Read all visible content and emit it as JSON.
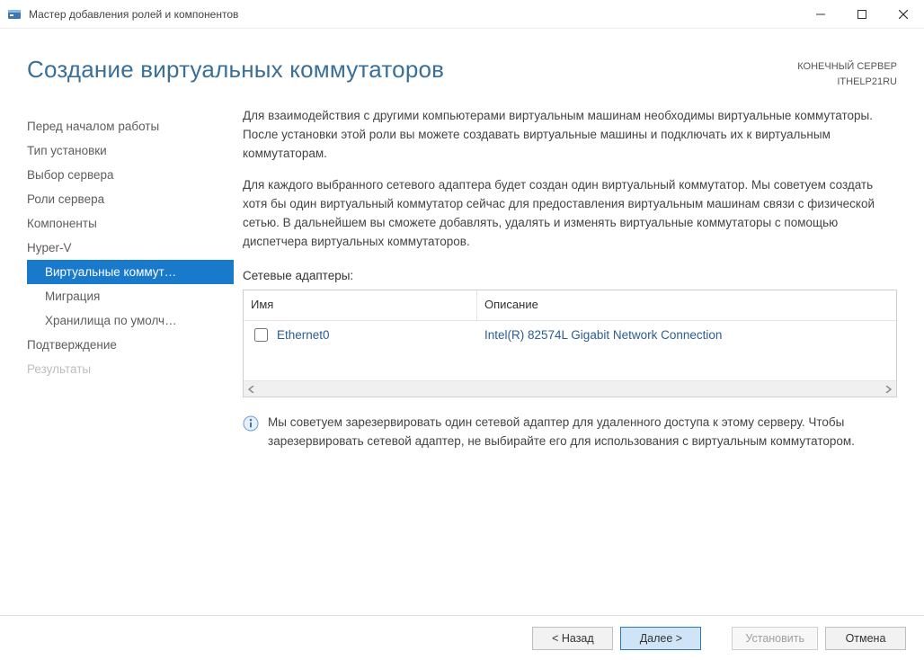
{
  "window": {
    "title": "Мастер добавления ролей и компонентов"
  },
  "header": {
    "page_title": "Создание виртуальных коммутаторов",
    "dest_label": "КОНЕЧНЫЙ СЕРВЕР",
    "dest_server": "ITHELP21RU"
  },
  "sidebar": {
    "items": [
      {
        "label": "Перед началом работы",
        "type": "normal"
      },
      {
        "label": "Тип установки",
        "type": "normal"
      },
      {
        "label": "Выбор сервера",
        "type": "normal"
      },
      {
        "label": "Роли сервера",
        "type": "normal"
      },
      {
        "label": "Компоненты",
        "type": "normal"
      },
      {
        "label": "Hyper-V",
        "type": "normal"
      },
      {
        "label": "Виртуальные коммут…",
        "type": "selected-sub"
      },
      {
        "label": "Миграция",
        "type": "sub"
      },
      {
        "label": "Хранилища по умолч…",
        "type": "sub"
      },
      {
        "label": "Подтверждение",
        "type": "normal"
      },
      {
        "label": "Результаты",
        "type": "disabled"
      }
    ]
  },
  "content": {
    "para1": "Для взаимодействия с другими компьютерами виртуальным машинам необходимы виртуальные коммутаторы. После установки этой роли вы можете создавать виртуальные машины и подключать их к виртуальным коммутаторам.",
    "para2": "Для каждого выбранного сетевого адаптера будет создан один виртуальный коммутатор. Мы советуем создать хотя бы один виртуальный коммутатор сейчас для предоставления виртуальным машинам связи с физической сетью. В дальнейшем вы сможете добавлять, удалять и изменять виртуальные коммутаторы с помощью диспетчера виртуальных коммутаторов.",
    "adapters_label": "Сетевые адаптеры:",
    "columns": {
      "name": "Имя",
      "desc": "Описание"
    },
    "rows": [
      {
        "name": "Ethernet0",
        "desc": "Intel(R) 82574L Gigabit Network Connection",
        "checked": false
      }
    ],
    "info_note": "Мы советуем зарезервировать один сетевой адаптер для удаленного доступа к этому серверу. Чтобы зарезервировать сетевой адаптер, не выбирайте его для использования с виртуальным коммутатором."
  },
  "footer": {
    "back": "< Назад",
    "next": "Далее >",
    "install": "Установить",
    "cancel": "Отмена"
  }
}
